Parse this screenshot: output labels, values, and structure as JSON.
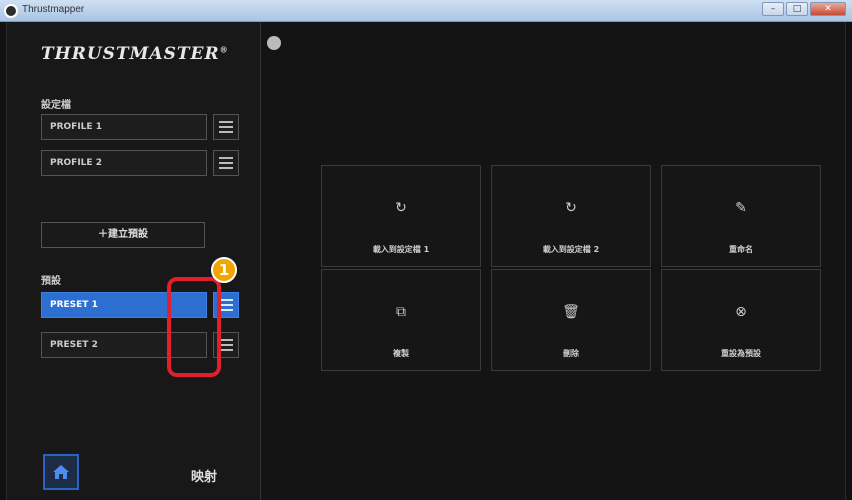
{
  "window": {
    "title": "Thrustmapper",
    "controls": [
      "–",
      "□",
      "✕"
    ]
  },
  "brand": {
    "logo_text": "THRUSTMASTER",
    "registered": "®"
  },
  "profiles": {
    "label": "設定檔",
    "items": [
      {
        "label": "PROFILE 1"
      },
      {
        "label": "PROFILE 2"
      }
    ]
  },
  "create_button": {
    "label": "＋建立預設"
  },
  "presets": {
    "label": "預設",
    "items": [
      {
        "label": "PRESET 1",
        "active": true
      },
      {
        "label": "PRESET 2",
        "active": false
      }
    ]
  },
  "callout": {
    "number": "1",
    "color": "#e0202a"
  },
  "bottom": {
    "mapping_label": "映射"
  },
  "actions": [
    {
      "icon": "reload-icon",
      "glyph": "↻",
      "label": "載入到設定檔 1"
    },
    {
      "icon": "reload-icon",
      "glyph": "↻",
      "label": "載入到設定檔 2"
    },
    {
      "icon": "pencil-icon",
      "glyph": "✎",
      "label": "重命名"
    },
    {
      "icon": "copy-icon",
      "glyph": "⧉",
      "label": "複製"
    },
    {
      "icon": "trash-icon",
      "glyph": "🗑",
      "label": "刪除"
    },
    {
      "icon": "circle-x-icon",
      "glyph": "⊗",
      "label": "重設為預設"
    }
  ],
  "colors": {
    "accent": "#2d6fd0",
    "highlight": "#e0202a",
    "badge": "#f0a500"
  }
}
